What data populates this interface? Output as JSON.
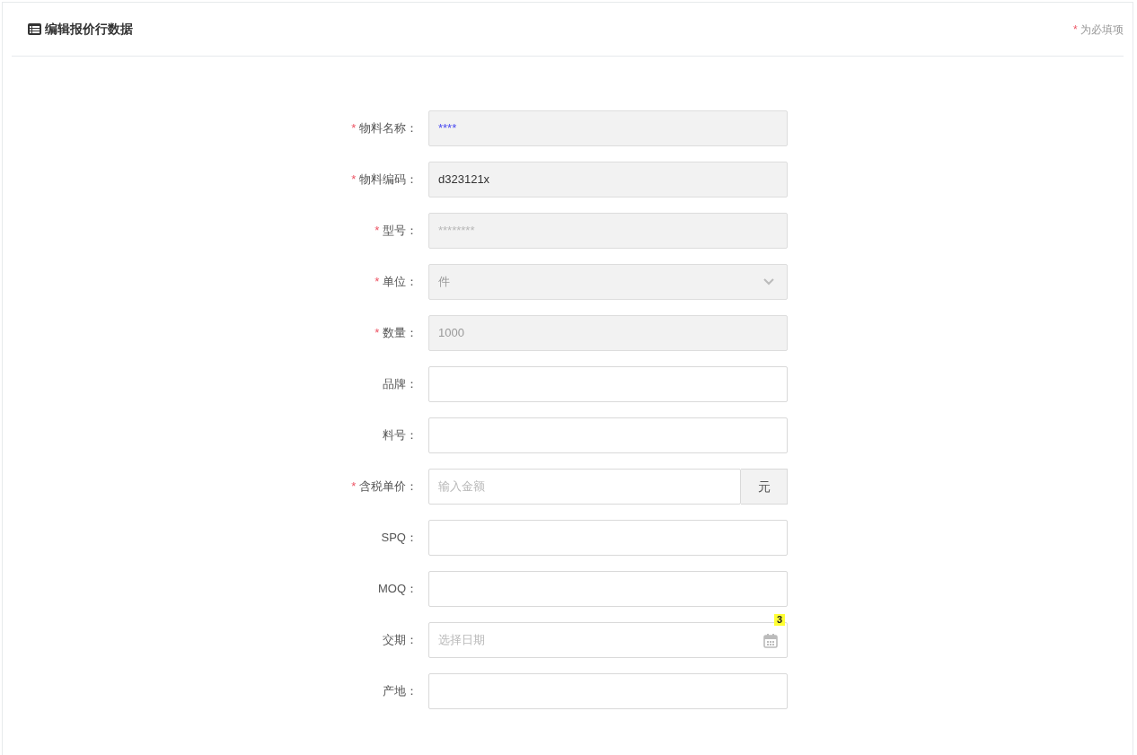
{
  "card": {
    "title": "编辑报价行数据",
    "required_note": {
      "mark": "*",
      "text": "为必填项"
    }
  },
  "fields": [
    {
      "label": "物料名称：",
      "required": true,
      "kind": "text",
      "disabled": true,
      "value": "****",
      "color": "#4b4bf0"
    },
    {
      "label": "物料编码：",
      "required": true,
      "kind": "text",
      "disabled": true,
      "value": "d323121x"
    },
    {
      "label": "型号：",
      "required": true,
      "kind": "text",
      "disabled": true,
      "placeholder": "********"
    },
    {
      "label": "单位：",
      "required": true,
      "kind": "select",
      "disabled": true,
      "value": "件",
      "muted": true
    },
    {
      "label": "数量：",
      "required": true,
      "kind": "text",
      "disabled": true,
      "value": "1000",
      "muted": true
    },
    {
      "label": "品牌：",
      "required": false,
      "kind": "text",
      "disabled": false
    },
    {
      "label": "料号：",
      "required": false,
      "kind": "text",
      "disabled": false
    },
    {
      "label": "含税单价：",
      "required": true,
      "kind": "addon",
      "disabled": false,
      "placeholder": "输入金额",
      "addon": "元"
    },
    {
      "label": "SPQ：",
      "required": false,
      "kind": "text",
      "disabled": false
    },
    {
      "label": "MOQ：",
      "required": false,
      "kind": "text",
      "disabled": false
    },
    {
      "label": "交期：",
      "required": false,
      "kind": "date",
      "disabled": false,
      "placeholder": "选择日期",
      "badge": "3"
    },
    {
      "label": "产地：",
      "required": false,
      "kind": "text",
      "disabled": false
    }
  ]
}
